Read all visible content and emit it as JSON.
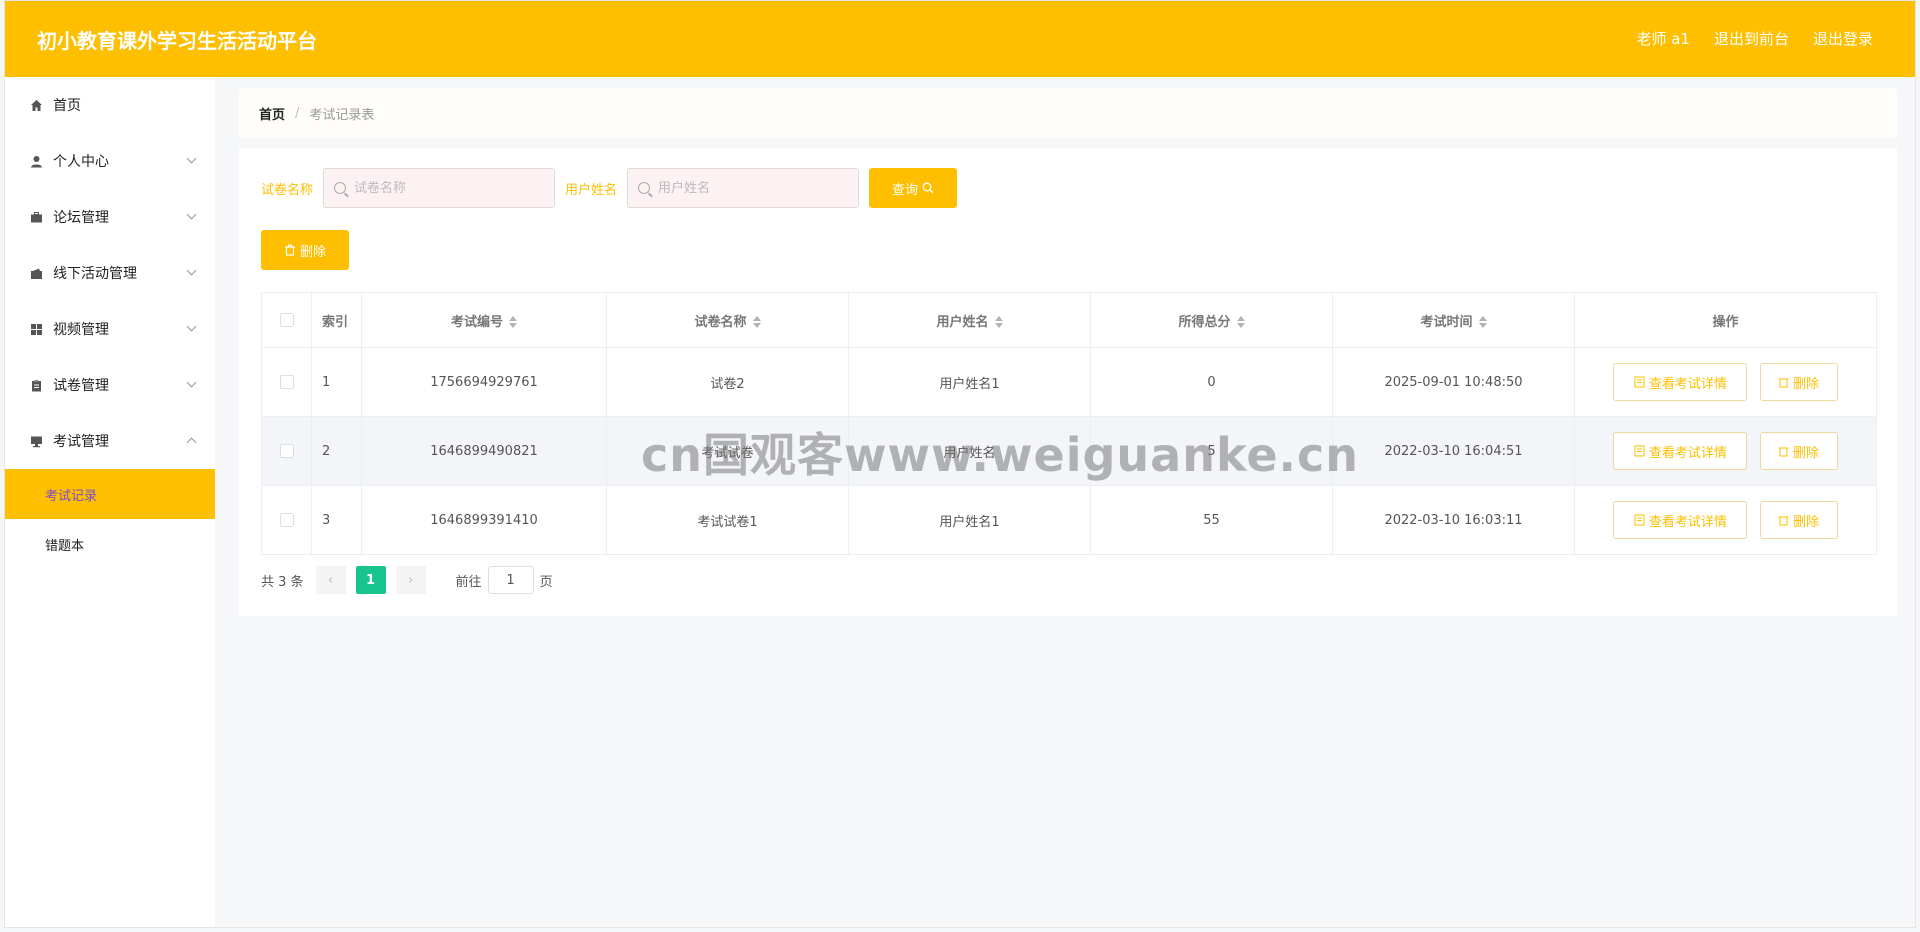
{
  "header": {
    "title": "初小教育课外学习生活活动平台",
    "links": [
      "老师 a1",
      "退出到前台",
      "退出登录"
    ]
  },
  "sidebar": {
    "items": [
      {
        "label": "首页",
        "icon": "home-icon"
      },
      {
        "label": "个人中心",
        "icon": "user-icon"
      },
      {
        "label": "论坛管理",
        "icon": "briefcase-icon"
      },
      {
        "label": "线下活动管理",
        "icon": "wallet-icon"
      },
      {
        "label": "视频管理",
        "icon": "grid-icon"
      },
      {
        "label": "试卷管理",
        "icon": "clipboard-icon"
      },
      {
        "label": "考试管理",
        "icon": "monitor-icon"
      }
    ],
    "sub_items": [
      {
        "label": "考试记录",
        "active": true
      },
      {
        "label": "错题本",
        "active": false
      }
    ]
  },
  "breadcrumb": {
    "home": "首页",
    "separator": "/",
    "current": "考试记录表"
  },
  "search": {
    "paper_label": "试卷名称",
    "paper_placeholder": "试卷名称",
    "user_label": "用户姓名",
    "user_placeholder": "用户姓名",
    "query_label": "查询"
  },
  "toolbar": {
    "delete_label": "删除"
  },
  "table": {
    "headers": [
      "索引",
      "考试编号",
      "试卷名称",
      "用户姓名",
      "所得总分",
      "考试时间",
      "操作"
    ],
    "rows": [
      {
        "index": "1",
        "exam_no": "1756694929761",
        "paper": "试卷2",
        "user": "用户姓名1",
        "score": "0",
        "time": "2025-09-01 10:48:50"
      },
      {
        "index": "2",
        "exam_no": "1646899490821",
        "paper": "考试试卷",
        "user": "用户姓名",
        "score": "5",
        "time": "2022-03-10 16:04:51"
      },
      {
        "index": "3",
        "exam_no": "1646899391410",
        "paper": "考试试卷1",
        "user": "用户姓名1",
        "score": "55",
        "time": "2022-03-10 16:03:11"
      }
    ],
    "detail_label": "查看考试详情",
    "delete_label": "删除"
  },
  "pagination": {
    "total": "共 3 条",
    "current": "1",
    "goto": "前往",
    "page_input": "1",
    "page_suffix": "页"
  },
  "watermark": "cn国观客www.weiguanke.cn",
  "colors": {
    "accent": "#fdbf00",
    "active_page": "#18c48d",
    "active_sub_text": "#7a4bd0"
  }
}
